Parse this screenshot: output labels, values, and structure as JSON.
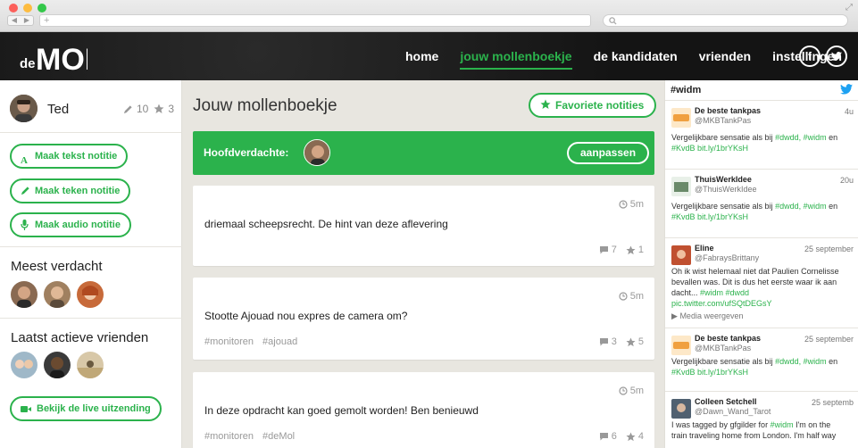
{
  "browser": {
    "url_text": "+",
    "dots": [
      "#fc605b",
      "#fdbc40",
      "#34c84a"
    ]
  },
  "header": {
    "logo_text": "deMOL",
    "nav": [
      {
        "label": "home",
        "active": false
      },
      {
        "label": "jouw mollenboekje",
        "active": true
      },
      {
        "label": "de kandidaten",
        "active": false
      },
      {
        "label": "vrienden",
        "active": false
      },
      {
        "label": "instellingen",
        "active": false
      }
    ],
    "social": {
      "facebook": "f",
      "twitter": "t"
    }
  },
  "sidebar": {
    "user": {
      "name": "Ted",
      "notes": "10",
      "stars": "3"
    },
    "actions": [
      {
        "label": "Maak tekst notitie",
        "icon": "text-icon"
      },
      {
        "label": "Maak teken notitie",
        "icon": "pencil-icon"
      },
      {
        "label": "Maak audio notitie",
        "icon": "microphone-icon"
      }
    ],
    "most_suspected_title": "Meest verdacht",
    "recent_friends_title": "Laatst actieve vrienden",
    "live_button": "Bekijk de live uitzending"
  },
  "main": {
    "title": "Jouw mollenboekje",
    "favorite_button": "Favoriete notities",
    "suspect_label": "Hoofdverdachte:",
    "adjust_button": "aanpassen",
    "notes": [
      {
        "time": "5m",
        "text": "driemaal scheepsrecht. De hint van deze aflevering",
        "tags": [],
        "comments": "7",
        "stars": "1"
      },
      {
        "time": "5m",
        "text": "Stootte Ajouad nou expres de camera om?",
        "tags": [
          "#monitoren",
          "#ajouad"
        ],
        "comments": "3",
        "stars": "5"
      },
      {
        "time": "5m",
        "text": "In deze opdracht kan goed gemolt worden! Ben benieuwd",
        "tags": [
          "#monitoren",
          "#deMol"
        ],
        "comments": "6",
        "stars": "4"
      }
    ]
  },
  "twitter": {
    "hashtag": "#widm",
    "tweets": [
      {
        "name": "De beste tankpas",
        "handle": "@MKBTankPas",
        "time": "4u",
        "body_plain": "Vergelijkbare sensatie als bij ",
        "body_tags": "#dwdd, #widm",
        "body_mid": " en",
        "body_line2": "#KvdB bit.ly/1brYKsH"
      },
      {
        "name": "ThuisWerkIdee",
        "handle": "@ThuisWerkIdee",
        "time": "20u",
        "body_plain": "Vergelijkbare sensatie als bij ",
        "body_tags": "#dwdd, #widm",
        "body_mid": " en",
        "body_line2": "#KvdB bit.ly/1brYKsH"
      },
      {
        "name": "Eline",
        "handle": "@FabraysBrittany",
        "time": "25 september",
        "line1": "Oh ik wist helemaal niet dat Paulien Cornelisse",
        "line2": "bevallen was. Dit is dus het eerste waar ik aan",
        "line3_plain": "dacht... ",
        "line3_tags": "#widm #dwdd",
        "line4": "pic.twitter.com/ufSQtDEGsY",
        "media": "Media weergeven"
      },
      {
        "name": "De beste tankpas",
        "handle": "@MKBTankPas",
        "time": "25 september",
        "body_plain": "Vergelijkbare sensatie als bij ",
        "body_tags": "#dwdd, #widm",
        "body_mid": " en",
        "body_line2": "#KvdB bit.ly/1brYKsH"
      },
      {
        "name": "Colleen Setchell",
        "handle": "@Dawn_Wand_Tarot",
        "time": "25 septemb",
        "line1_plain": "I was tagged by gfgilder for ",
        "line1_tag": "#widm",
        "line1_end": " I'm on the",
        "line2": "train traveling home from London. I'm half way"
      }
    ]
  },
  "colors": {
    "accent": "#2bb24c",
    "header_bg": "#1a1a1a"
  }
}
